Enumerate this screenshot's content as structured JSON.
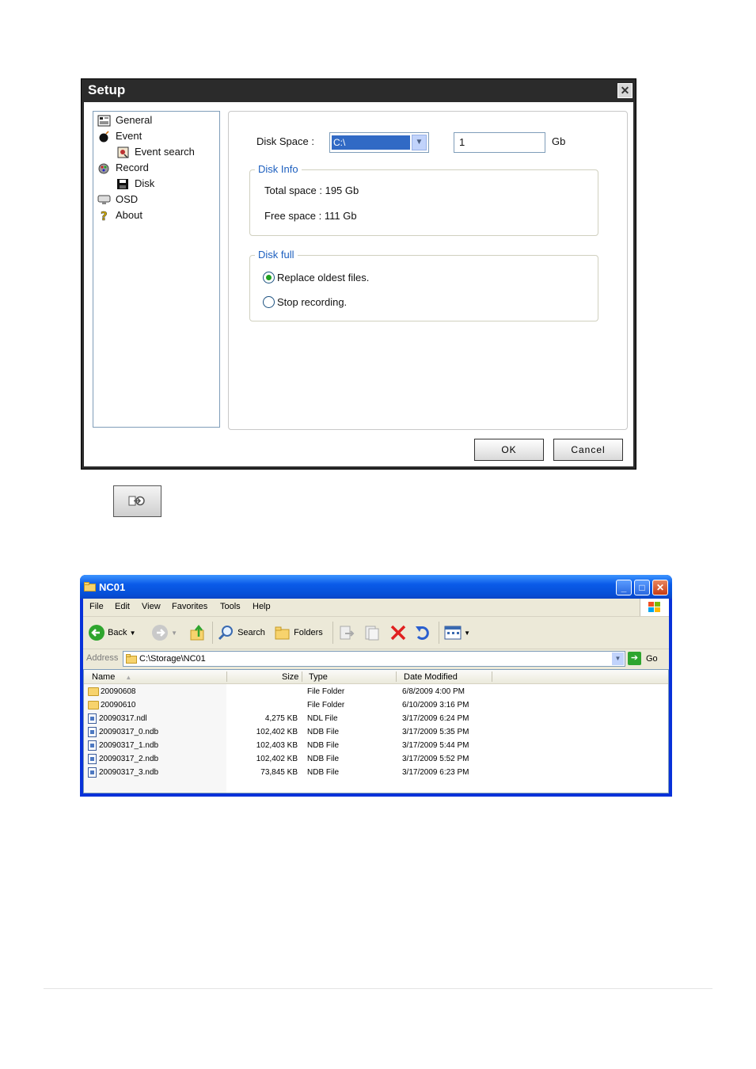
{
  "setup": {
    "title": "Setup",
    "close": "✕",
    "tree": [
      {
        "label": "General",
        "icon": "general-icon"
      },
      {
        "label": "Event",
        "icon": "bomb-icon"
      },
      {
        "label": "Event search",
        "icon": "event-search-icon"
      },
      {
        "label": "Record",
        "icon": "record-icon"
      },
      {
        "label": "Disk",
        "icon": "floppy-disk-icon"
      },
      {
        "label": "OSD",
        "icon": "osd-icon"
      },
      {
        "label": "About",
        "icon": "question-icon"
      }
    ],
    "disk_space_label": "Disk Space :",
    "disk_space_value": "C:\\",
    "size_value": "1",
    "size_unit": "Gb",
    "disk_info": {
      "legend": "Disk Info",
      "total": "Total space : 195 Gb",
      "free": "Free space : 111 Gb"
    },
    "disk_full": {
      "legend": "Disk full",
      "options": [
        "Replace oldest files.",
        "Stop recording."
      ],
      "selected": 0
    },
    "ok": "OK",
    "cancel": "Cancel"
  },
  "explorer": {
    "title": "NC01",
    "menu": [
      "File",
      "Edit",
      "View",
      "Favorites",
      "Tools",
      "Help"
    ],
    "toolbar": {
      "back": "Back",
      "search": "Search",
      "folders": "Folders"
    },
    "address_label": "Address",
    "address": "C:\\Storage\\NC01",
    "go": "Go",
    "columns": [
      "Name",
      "Size",
      "Type",
      "Date Modified"
    ],
    "rows": [
      {
        "name": "20090608",
        "size": "",
        "type": "File Folder",
        "date": "6/8/2009 4:00 PM",
        "folder": true
      },
      {
        "name": "20090610",
        "size": "",
        "type": "File Folder",
        "date": "6/10/2009 3:16 PM",
        "folder": true
      },
      {
        "name": "20090317.ndl",
        "size": "4,275 KB",
        "type": "NDL File",
        "date": "3/17/2009 6:24 PM",
        "folder": false
      },
      {
        "name": "20090317_0.ndb",
        "size": "102,402 KB",
        "type": "NDB File",
        "date": "3/17/2009 5:35 PM",
        "folder": false
      },
      {
        "name": "20090317_1.ndb",
        "size": "102,403 KB",
        "type": "NDB File",
        "date": "3/17/2009 5:44 PM",
        "folder": false
      },
      {
        "name": "20090317_2.ndb",
        "size": "102,402 KB",
        "type": "NDB File",
        "date": "3/17/2009 5:52 PM",
        "folder": false
      },
      {
        "name": "20090317_3.ndb",
        "size": "73,845 KB",
        "type": "NDB File",
        "date": "3/17/2009 6:23 PM",
        "folder": false
      }
    ]
  }
}
